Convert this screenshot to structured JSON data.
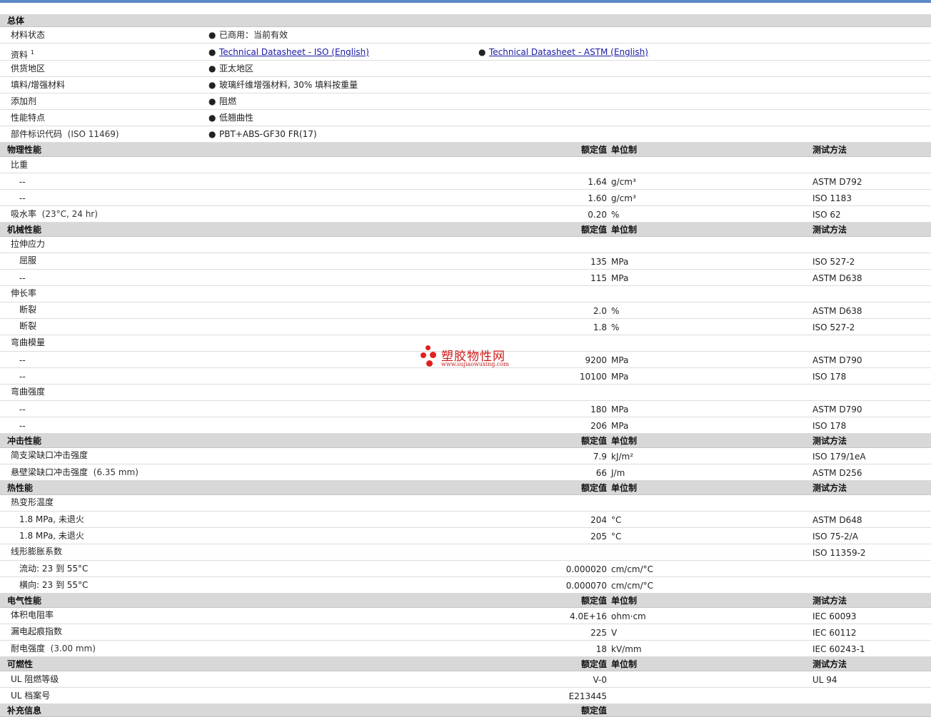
{
  "sections": {
    "general": "总体",
    "physical": "物理性能",
    "mechanical": "机械性能",
    "impact": "冲击性能",
    "thermal": "热性能",
    "electrical": "电气性能",
    "flammability": "可燃性",
    "supplementary": "补充信息"
  },
  "headers": {
    "value": "额定值",
    "unit": "单位制",
    "test": "测试方法"
  },
  "general": {
    "material_status": {
      "label": "材料状态",
      "value": "已商用：当前有效"
    },
    "documents": {
      "label": "资料",
      "sup": "1",
      "link1": "Technical Datasheet - ISO (English)",
      "link2": "Technical Datasheet - ASTM (English)"
    },
    "region": {
      "label": "供货地区",
      "value": "亚太地区"
    },
    "filler": {
      "label": "填料/增强材料",
      "value": "玻璃纤维增强材料, 30% 填料按重量"
    },
    "additive": {
      "label": "添加剂",
      "value": "阻燃"
    },
    "features": {
      "label": "性能特点",
      "value": "低翘曲性"
    },
    "part_code": {
      "label": "部件标识代码",
      "note": "(ISO 11469)",
      "value": "PBT+ABS-GF30 FR(17)"
    }
  },
  "physical": {
    "sg": {
      "label": "比重"
    },
    "sg1": {
      "label": "--",
      "value": "1.64",
      "unit": "g/cm³",
      "test": "ASTM D792"
    },
    "sg2": {
      "label": "--",
      "value": "1.60",
      "unit": "g/cm³",
      "test": "ISO 1183"
    },
    "water": {
      "label": "吸水率",
      "note": "(23°C, 24 hr)",
      "value": "0.20",
      "unit": "%",
      "test": "ISO 62"
    }
  },
  "mechanical": {
    "tensile": {
      "label": "拉伸应力"
    },
    "tensile1": {
      "label": "屈服",
      "value": "135",
      "unit": "MPa",
      "test": "ISO 527-2"
    },
    "tensile2": {
      "label": "--",
      "value": "115",
      "unit": "MPa",
      "test": "ASTM D638"
    },
    "elong": {
      "label": "伸长率"
    },
    "elong1": {
      "label": "断裂",
      "value": "2.0",
      "unit": "%",
      "test": "ASTM D638"
    },
    "elong2": {
      "label": "断裂",
      "value": "1.8",
      "unit": "%",
      "test": "ISO 527-2"
    },
    "flexmod": {
      "label": "弯曲模量"
    },
    "flexmod1": {
      "label": "--",
      "value": "9200",
      "unit": "MPa",
      "test": "ASTM D790"
    },
    "flexmod2": {
      "label": "--",
      "value": "10100",
      "unit": "MPa",
      "test": "ISO 178"
    },
    "flexstr": {
      "label": "弯曲强度"
    },
    "flexstr1": {
      "label": "--",
      "value": "180",
      "unit": "MPa",
      "test": "ASTM D790"
    },
    "flexstr2": {
      "label": "--",
      "value": "206",
      "unit": "MPa",
      "test": "ISO 178"
    }
  },
  "impact": {
    "charpy": {
      "label": "简支梁缺口冲击强度",
      "value": "7.9",
      "unit": "kJ/m²",
      "test": "ISO 179/1eA"
    },
    "izod": {
      "label": "悬壁梁缺口冲击强度",
      "note": "(6.35 mm)",
      "value": "66",
      "unit": "J/m",
      "test": "ASTM D256"
    }
  },
  "thermal": {
    "hdt": {
      "label": "热变形温度"
    },
    "hdt1": {
      "label": "1.8 MPa, 未退火",
      "value": "204",
      "unit": "°C",
      "test": "ASTM D648"
    },
    "hdt2": {
      "label": "1.8 MPa, 未退火",
      "value": "205",
      "unit": "°C",
      "test": "ISO 75-2/A"
    },
    "clte": {
      "label": "线形膨胀系数",
      "test": "ISO 11359-2"
    },
    "clte1": {
      "label": "流动: 23 到  55°C",
      "value": "0.000020",
      "unit": "cm/cm/°C"
    },
    "clte2": {
      "label": "横向: 23 到  55°C",
      "value": "0.000070",
      "unit": "cm/cm/°C"
    }
  },
  "electrical": {
    "vr": {
      "label": "体积电阻率",
      "value": "4.0E+16",
      "unit": "ohm·cm",
      "test": "IEC 60093"
    },
    "cti": {
      "label": "漏电起痕指数",
      "value": "225",
      "unit": "V",
      "test": "IEC 60112"
    },
    "ds": {
      "label": "耐电强度",
      "note": "(3.00 mm)",
      "value": "18",
      "unit": "kV/mm",
      "test": "IEC 60243-1"
    }
  },
  "flammability": {
    "ul94": {
      "label": "UL 阻燃等级",
      "value": "V-0",
      "test": "UL 94"
    },
    "file": {
      "label": "UL 档案号",
      "value": "E213445"
    }
  },
  "watermark": {
    "title": "塑胶物性网",
    "url": "www.sujiaowuxing.com"
  }
}
